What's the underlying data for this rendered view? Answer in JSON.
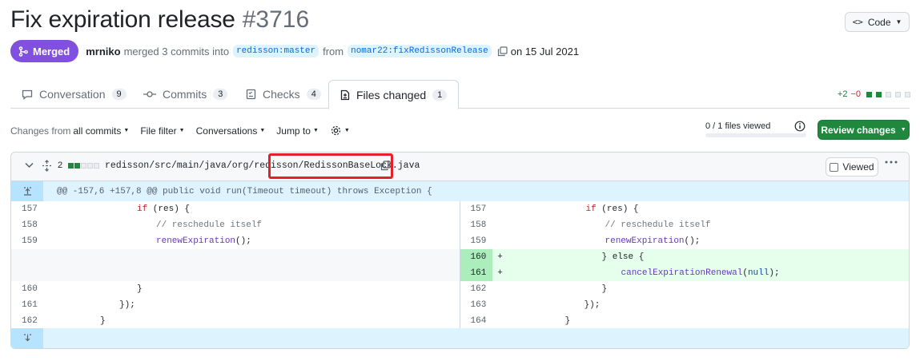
{
  "pr": {
    "title": "Fix expiration release",
    "number": "#3716",
    "status": "Merged",
    "author": "mrniko",
    "merge_text": "merged 3 commits into",
    "base_branch": "redisson:master",
    "from_text": "from",
    "head_branch": "nomar22:fixRedissonRelease",
    "date_text": "on 15 Jul 2021"
  },
  "code_button": "Code",
  "tabs": [
    {
      "label": "Conversation",
      "count": "9",
      "icon": "comment-icon"
    },
    {
      "label": "Commits",
      "count": "3",
      "icon": "commit-icon"
    },
    {
      "label": "Checks",
      "count": "4",
      "icon": "checklist-icon"
    },
    {
      "label": "Files changed",
      "count": "1",
      "icon": "file-diff-icon",
      "active": true
    }
  ],
  "diffstat": {
    "additions": "+2",
    "deletions": "−0"
  },
  "toolbar": {
    "changes_from_prefix": "Changes from",
    "changes_from_value": "all commits",
    "file_filter": "File filter",
    "conversations": "Conversations",
    "jump_to": "Jump to",
    "viewed_count": "0 / 1 files viewed",
    "review_button": "Review changes"
  },
  "file": {
    "changes": "2",
    "path_prefix": "redisson/src/main/java/org/redisson",
    "filename": "/RedissonBaseLock.java",
    "viewed_label": "Viewed",
    "hunk_header": "@@ -157,6 +157,8 @@ public void run(Timeout timeout) throws Exception {"
  },
  "diff_rows": [
    {
      "left_ln": "157",
      "right_ln": "157"
    },
    {
      "left_ln": "158",
      "right_ln": "158"
    },
    {
      "left_ln": "159",
      "right_ln": "159"
    },
    {
      "left_ln": "",
      "right_ln": "160"
    },
    {
      "left_ln": "",
      "right_ln": "161"
    },
    {
      "left_ln": "160",
      "right_ln": "162"
    },
    {
      "left_ln": "161",
      "right_ln": "163"
    },
    {
      "left_ln": "162",
      "right_ln": "164"
    }
  ],
  "code_tokens": {
    "if_kw": "if",
    "res_cond": " (res) {",
    "comment": "// reschedule itself",
    "renew_fn": "renewExpiration",
    "call_end": "();",
    "else_line": "} else {",
    "cancel_fn": "cancelExpirationRenewal",
    "null_lit": "null",
    "cancel_end": ");",
    "close_brace": "}",
    "close_paren": "});",
    "plus": "+"
  },
  "colors": {
    "merged": "#8250df",
    "primary_button": "#1f883d",
    "highlight_box": "#e5202a"
  }
}
